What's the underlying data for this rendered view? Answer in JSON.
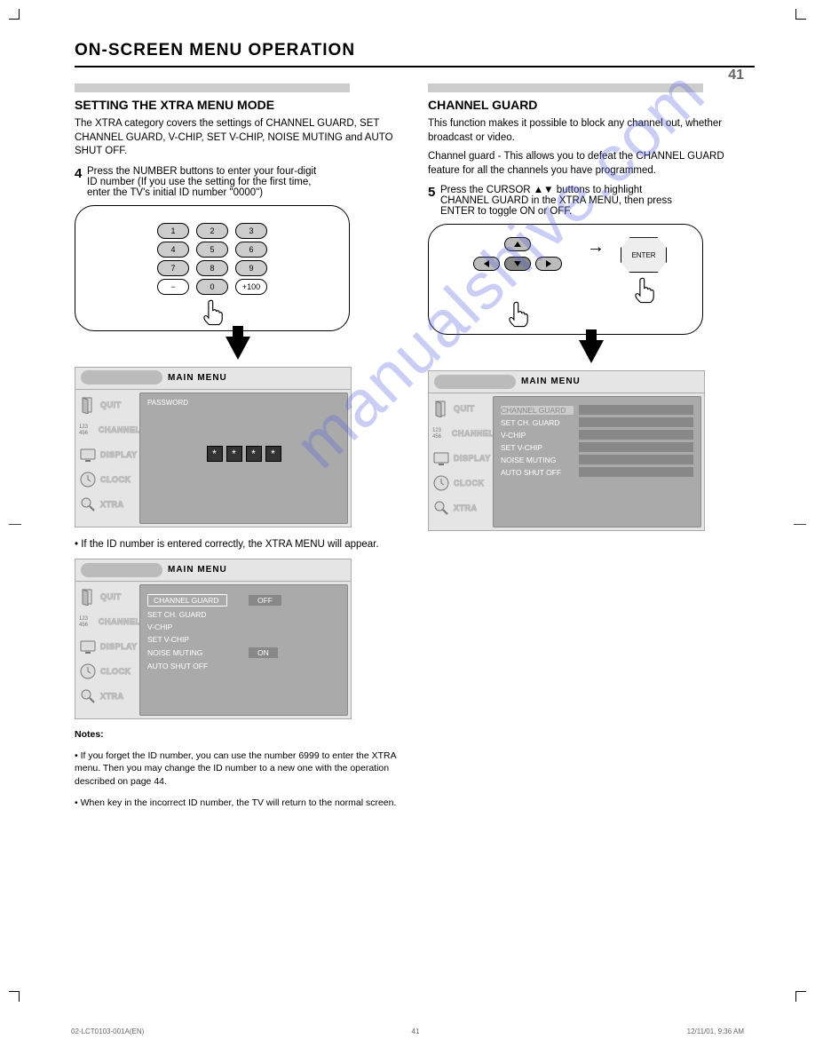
{
  "page_number": "41",
  "header_title": "ON-SCREEN MENU OPERATION",
  "watermark": "manualshive.com",
  "left": {
    "subtitle": "SETTING THE XTRA MENU MODE",
    "intro": "The XTRA category covers the settings of CHANNEL GUARD, SET CHANNEL GUARD, V-CHIP, SET V-CHIP, NOISE MUTING and AUTO SHUT OFF.",
    "step4_text": "Press the NUMBER buttons to enter your four-digit ID number (If you use the setting for the first time, enter the TV's initial ID number \"0000\")",
    "remote_keys": [
      "1",
      "2",
      "3",
      "4",
      "5",
      "6",
      "7",
      "8",
      "9",
      "−",
      "0",
      "+100"
    ],
    "menu1": {
      "title_label": "MAIN MENU",
      "side": [
        "QUIT",
        "CHANNEL",
        "DISPLAY",
        "CLOCK",
        "XTRA"
      ],
      "pane_label": "PASSWORD",
      "stars": [
        "*",
        "*",
        "*",
        "*"
      ]
    },
    "bullet": "If the ID number is entered correctly, the XTRA MENU will appear.",
    "menu2": {
      "title_label": "MAIN MENU",
      "rows": [
        {
          "k": "CHANNEL GUARD",
          "v": "OFF",
          "boxed": true
        },
        {
          "k": "SET CH. GUARD",
          "v": ""
        },
        {
          "k": "V-CHIP",
          "v": ""
        },
        {
          "k": "SET V-CHIP",
          "v": ""
        },
        {
          "k": "NOISE MUTING",
          "v": "ON"
        },
        {
          "k": "AUTO SHUT OFF",
          "v": ""
        }
      ]
    },
    "notes_h": "Notes:",
    "notes": [
      "If you forget the ID number, you can use the number 6999 to enter the XTRA menu. Then you may change the ID number to a new one with the operation described on page 44.",
      "When key in the incorrect ID number, the TV will return to the normal screen."
    ]
  },
  "right": {
    "subtitle": "CHANNEL GUARD",
    "para1": "This function makes it possible to block any channel out, whether broadcast or video.",
    "para2": "Channel guard - This allows you to defeat the CHANNEL GUARD feature for all the channels you have programmed.",
    "step5_num": "5",
    "step5_text": "Press the CURSOR ▲▼ buttons to highlight CHANNEL GUARD in the XTRA MENU, then press ENTER to toggle ON or OFF.",
    "enter_label": "ENTER",
    "menu": {
      "title_label": "MAIN MENU",
      "rows": [
        "CHANNEL GUARD",
        "SET CH. GUARD",
        "V-CHIP",
        "SET V-CHIP",
        "NOISE MUTING",
        "AUTO SHUT OFF"
      ]
    }
  },
  "side_labels": [
    "QUIT",
    "CHANNEL",
    "DISPLAY",
    "CLOCK",
    "XTRA"
  ],
  "footer": {
    "left": "02-LCT0103-001A(EN)",
    "center": "41",
    "right": "12/11/01, 9:36 AM"
  }
}
